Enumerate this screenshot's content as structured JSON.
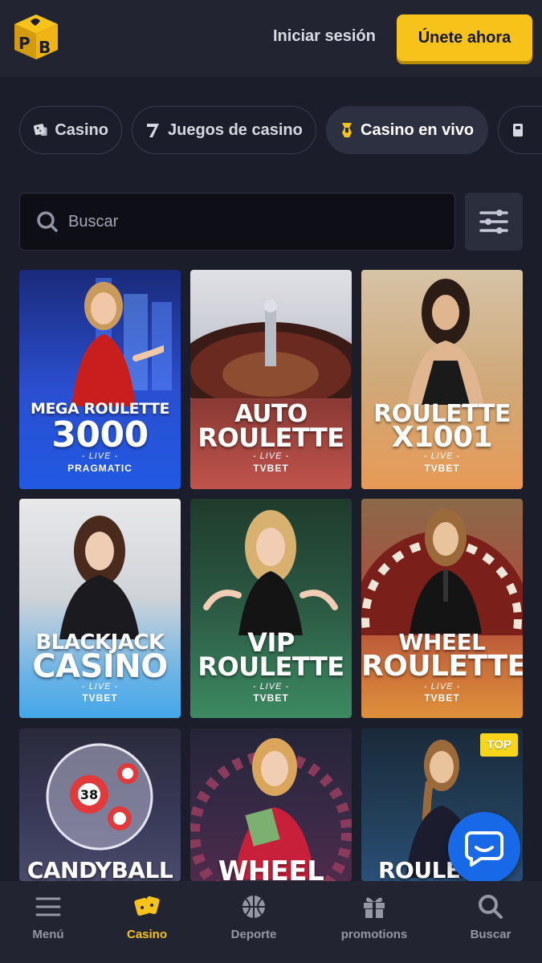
{
  "header": {
    "login_label": "Iniciar sesión",
    "join_label": "Únete ahora",
    "accent_color": "#f7c31a"
  },
  "tabs": [
    {
      "label": "Casino",
      "icon": "dice-icon"
    },
    {
      "label": "Juegos de casino",
      "icon": "seven-icon"
    },
    {
      "label": "Casino en vivo",
      "icon": "live-casino-icon",
      "active": true
    },
    {
      "label": "",
      "icon": "cards-icon"
    }
  ],
  "search": {
    "placeholder": "Buscar"
  },
  "games": [
    {
      "line1": "MEGA ROULETTE",
      "line2": "3000",
      "live": "- LIVE -",
      "provider": "PRAGMATIC"
    },
    {
      "line1": "AUTO",
      "line2": "ROULETTE",
      "live": "- LIVE -",
      "provider": "TVBET"
    },
    {
      "line1": "ROULETTE",
      "line2": "X1001",
      "live": "- LIVE -",
      "provider": "TVBET"
    },
    {
      "line1": "BLACKJACK",
      "line2": "CASINO",
      "live": "- LIVE -",
      "provider": "TVBET"
    },
    {
      "line1": "VIP",
      "line2": "ROULETTE",
      "live": "- LIVE -",
      "provider": "TVBET"
    },
    {
      "line1": "WHEEL",
      "line2": "ROULETTE",
      "live": "- LIVE -",
      "provider": "TVBET"
    },
    {
      "line1": "CANDYBALL",
      "line2": "",
      "live": "",
      "provider": ""
    },
    {
      "line1": "WHEEL",
      "line2": "",
      "live": "",
      "provider": ""
    },
    {
      "line1": "ROULETTE",
      "line2": "",
      "live": "",
      "provider": "",
      "badge": "TOP"
    }
  ],
  "bottom_nav": [
    {
      "label": "Menú",
      "icon": "hamburger-icon"
    },
    {
      "label": "Casino",
      "icon": "casino-icon",
      "active": true
    },
    {
      "label": "Deporte",
      "icon": "basketball-icon"
    },
    {
      "label": "promotions",
      "icon": "gift-icon"
    },
    {
      "label": "Buscar",
      "icon": "search-icon"
    }
  ]
}
